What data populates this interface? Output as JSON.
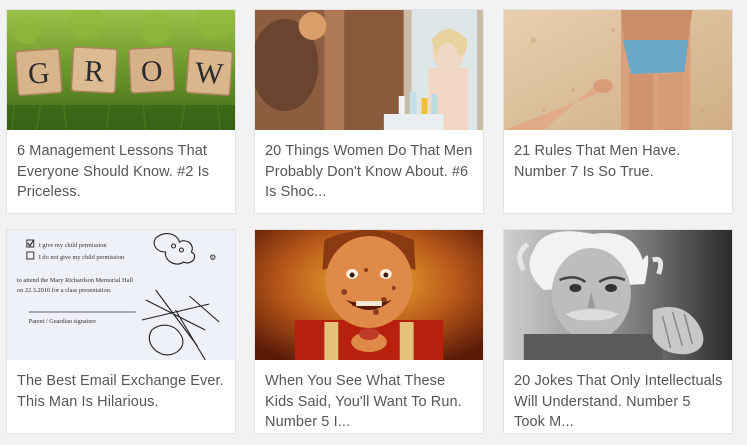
{
  "cards": [
    {
      "title": "6 Management Lessons That Everyone Should Know. #2 Is Priceless.",
      "image": "grow-scrabble-tiles-image",
      "tiles": [
        "G",
        "R",
        "O",
        "W"
      ]
    },
    {
      "title": "20 Things Women Do That Men Probably Don't Know About. #6 Is Shoc...",
      "image": "woman-mirror-image"
    },
    {
      "title": "21 Rules That Men Have. Number 7 Is So True.",
      "image": "beach-hand-holding-image"
    },
    {
      "title": "The Best Email Exchange Ever. This Man Is Hilarious.",
      "image": "permission-slip-image",
      "slip": {
        "line1": "I give my child permission",
        "line2": "I do not give my child permission",
        "line3": "to attend the Mary Richardson Memorial Hall",
        "line4": "on 22.3.2010 for a class presentation.",
        "line5": "Parent / Guardian signature"
      }
    },
    {
      "title": "When You See What These Kids Said, You'll Want To Run. Number 5 I...",
      "image": "messy-kid-image"
    },
    {
      "title": "20 Jokes That Only Intellectuals Will Understand. Number 5 Took M...",
      "image": "einstein-portrait-image"
    }
  ]
}
